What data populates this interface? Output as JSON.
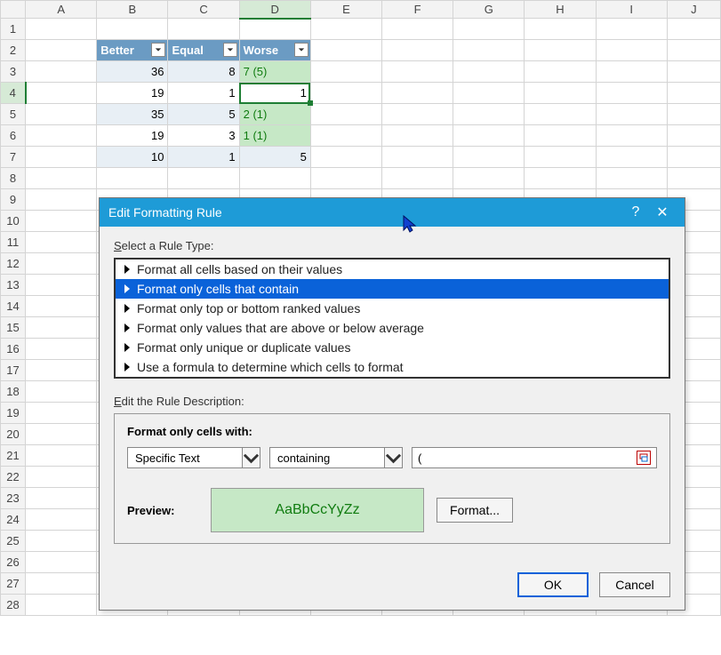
{
  "columns": [
    "A",
    "B",
    "C",
    "D",
    "E",
    "F",
    "G",
    "H",
    "I",
    "J"
  ],
  "rows": 28,
  "activeCol": "D",
  "activeRow": 4,
  "table": {
    "headers": {
      "B": "Better",
      "C": "Equal",
      "D": "Worse"
    },
    "data": [
      {
        "B": "36",
        "C": "8",
        "D": "7 (5)",
        "Dgreen": true
      },
      {
        "B": "19",
        "C": "1",
        "D": "1",
        "Dgreen": false,
        "active": true
      },
      {
        "B": "35",
        "C": "5",
        "D": "2 (1)",
        "Dgreen": true
      },
      {
        "B": "19",
        "C": "3",
        "D": "1 (1)",
        "Dgreen": true
      },
      {
        "B": "10",
        "C": "1",
        "D": "5",
        "Dgreen": false
      }
    ]
  },
  "dialog": {
    "title": "Edit Formatting Rule",
    "help": "?",
    "selectLabel": "Select a Rule Type:",
    "rules": [
      "Format all cells based on their values",
      "Format only cells that contain",
      "Format only top or bottom ranked values",
      "Format only values that are above or below average",
      "Format only unique or duplicate values",
      "Use a formula to determine which cells to format"
    ],
    "selectedRule": 1,
    "editLabel": "Edit the Rule Description:",
    "formatWith": "Format only cells with:",
    "combo1": "Specific Text",
    "combo2": "containing",
    "textValue": "(",
    "previewLabel": "Preview:",
    "previewText": "AaBbCcYyZz",
    "formatBtn": "Format...",
    "ok": "OK",
    "cancel": "Cancel"
  }
}
